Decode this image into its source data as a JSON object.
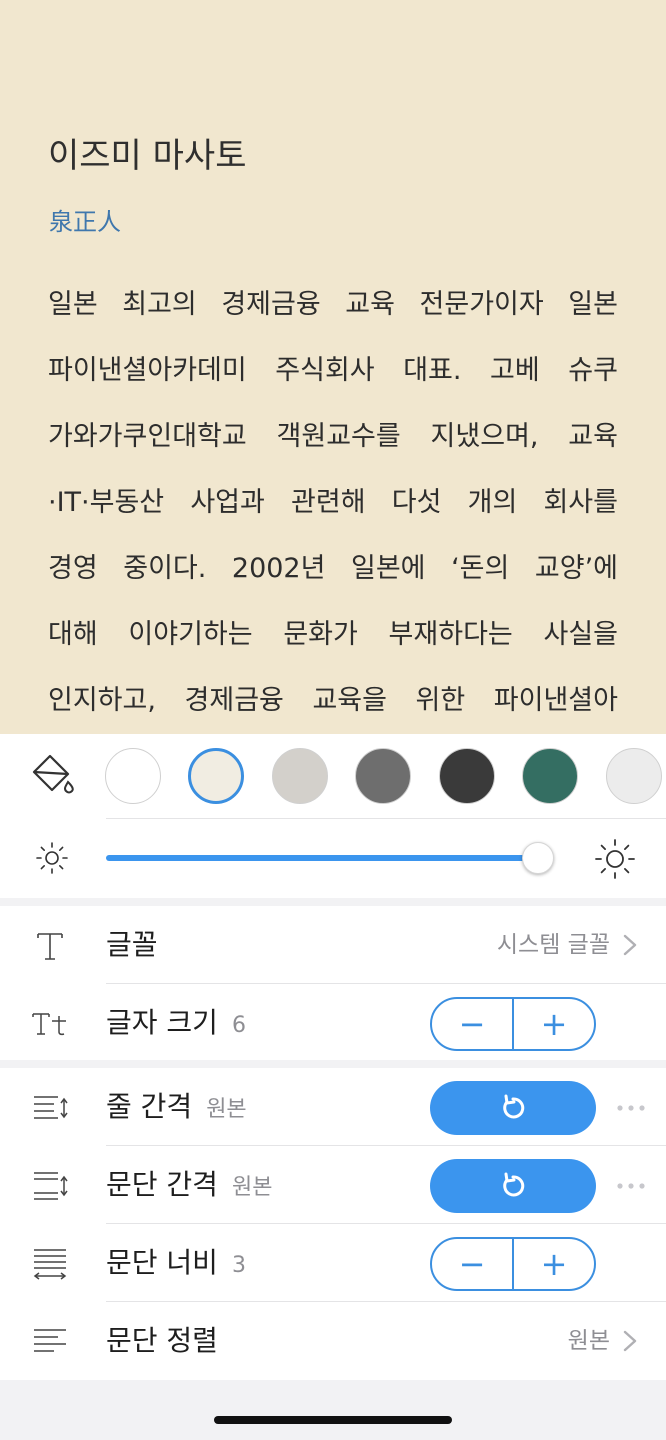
{
  "book": {
    "title": "이즈미 마사토",
    "subtitle": "泉正人",
    "lines": [
      "일본 최고의 경제금융 교육 전문가이자 일본",
      "파이낸셜아카데미 주식회사 대표. 고베 슈쿠",
      "가와가쿠인대학교 객원교수를 지냈으며, 교육",
      "·IT·부동산 사업과 관련해 다섯 개의 회사를",
      "경영 중이다. 2002년 일본에 ‘돈의 교양’에",
      "대해 이야기하는 문화가 부재하다는 사실을",
      "인지하고, 경제금융 교육을 위한 파이낸셜아"
    ]
  },
  "theme": {
    "icon": "paint-bucket-icon",
    "swatches": [
      {
        "color": "#ffffff",
        "selected": false
      },
      {
        "color": "#f1ede2",
        "selected": true
      },
      {
        "color": "#d3d0cb",
        "selected": false
      },
      {
        "color": "#6e6e6e",
        "selected": false
      },
      {
        "color": "#3a3a3a",
        "selected": false
      },
      {
        "color": "#346e62",
        "selected": false
      },
      {
        "color": "#ececec",
        "selected": false
      }
    ],
    "accent": "#3b8fe0",
    "brightness": 0.96
  },
  "settings": {
    "font": {
      "label": "글꼴",
      "value": "시스템 글꼴"
    },
    "font_size": {
      "label": "글자 크기",
      "value": "6",
      "minus": "−",
      "plus": "+"
    },
    "line_spacing": {
      "label": "줄 간격",
      "value": "원본"
    },
    "paragraph_spacing": {
      "label": "문단 간격",
      "value": "원본"
    },
    "paragraph_width": {
      "label": "문단 너비",
      "value": "3",
      "minus": "−",
      "plus": "+"
    },
    "paragraph_align": {
      "label": "문단 정렬",
      "value": "원본"
    }
  }
}
